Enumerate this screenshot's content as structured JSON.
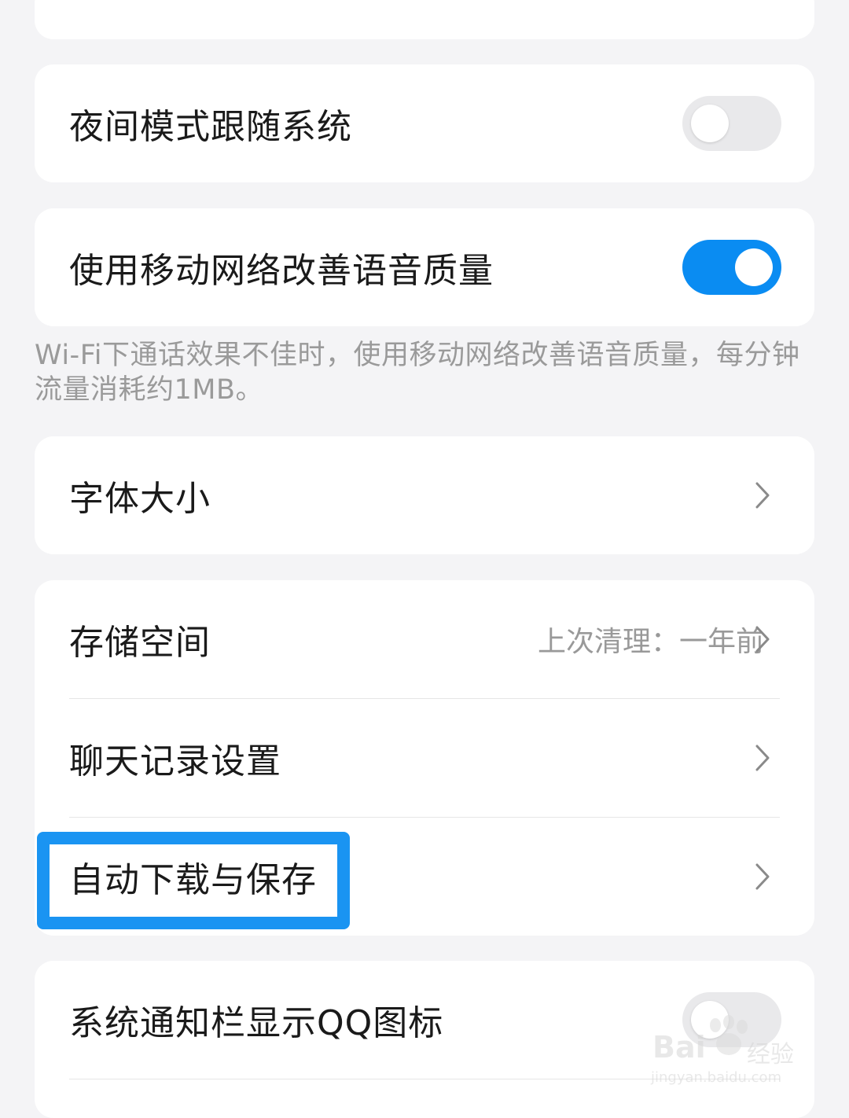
{
  "settings": {
    "night_mode": {
      "label": "夜间模式跟随系统",
      "toggle": "off"
    },
    "mobile_voice": {
      "label": "使用移动网络改善语音质量",
      "toggle": "on"
    },
    "mobile_voice_note": "Wi-Fi下通话效果不佳时，使用移动网络改善语音质量，每分钟流量消耗约1MB。",
    "font_size": {
      "label": "字体大小"
    },
    "storage": {
      "label": "存储空间",
      "value": "上次清理：一年前"
    },
    "chat_history": {
      "label": "聊天记录设置"
    },
    "auto_download": {
      "label": "自动下载与保存"
    },
    "notification_icon": {
      "label": "系统通知栏显示QQ图标",
      "toggle": "off"
    }
  },
  "watermark": {
    "brand": "Bai",
    "brand_suffix": "经验",
    "url": "jingyan.baidu.com"
  },
  "colors": {
    "background": "#f4f4f6",
    "card": "#ffffff",
    "accent": "#0a8cf2",
    "highlight": "#1a94f2",
    "secondary_text": "#999999"
  },
  "icons": {
    "chevron": "chevron-right-icon",
    "watermark_logo": "baidu-paw-icon"
  }
}
